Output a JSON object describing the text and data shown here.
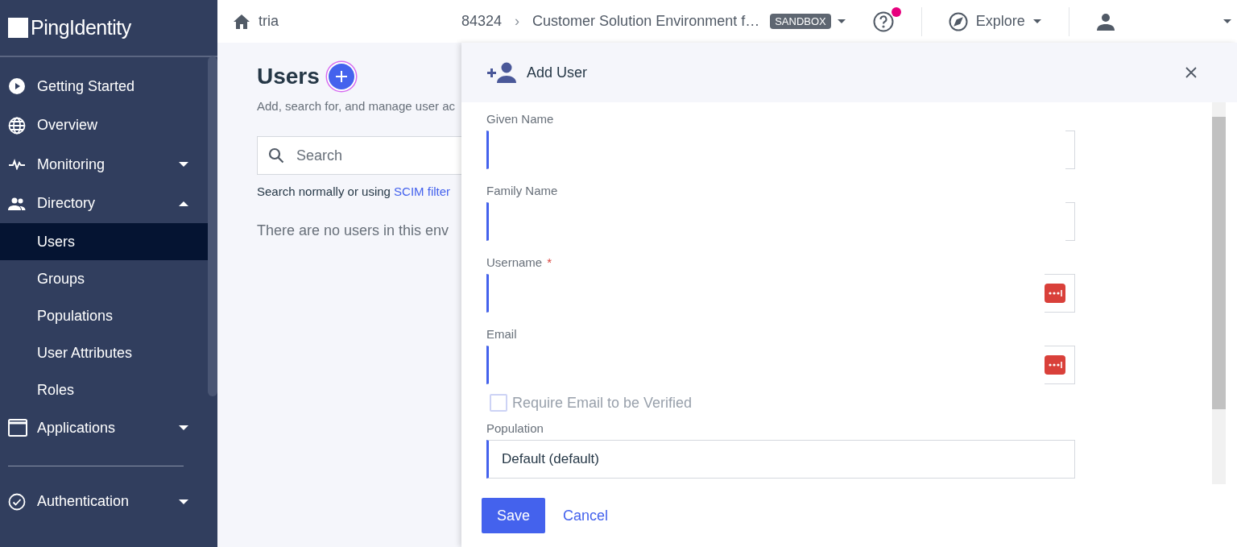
{
  "logo": {
    "text": "**Ping**Identity"
  },
  "topbar": {
    "home": "tria",
    "env_id": "84324",
    "separator": "›",
    "environment": "Customer Solution Environment f…",
    "badge": "SANDBOX",
    "help_notification": true,
    "explore": "Explore"
  },
  "sidebar": {
    "items": [
      {
        "kind": "section",
        "label": "Getting Started"
      },
      {
        "kind": "section",
        "label": "Overview"
      },
      {
        "kind": "section",
        "label": "Monitoring",
        "expanded": false
      },
      {
        "kind": "section",
        "label": "Directory",
        "expanded": true
      },
      {
        "kind": "child",
        "label": "Users",
        "selected": true
      },
      {
        "kind": "child",
        "label": "Groups",
        "selected": false
      },
      {
        "kind": "child",
        "label": "Populations",
        "selected": false
      },
      {
        "kind": "child",
        "label": "User Attributes",
        "selected": false
      },
      {
        "kind": "child",
        "label": "Roles",
        "selected": false
      },
      {
        "kind": "section",
        "label": "Applications",
        "expanded": false
      },
      {
        "kind": "divider"
      },
      {
        "kind": "section",
        "label": "Authentication",
        "expanded": false
      }
    ]
  },
  "page": {
    "title": "Users",
    "subtitle": "Add, search for, and manage user ac",
    "search": {
      "placeholder": "Search"
    },
    "hint": "Search normally or using ",
    "hint_link": "SCIM filter",
    "empty": "There are no users in this env"
  },
  "drawer": {
    "title": "Add User",
    "required_mark": "*",
    "fields": [
      {
        "kind": "text",
        "label": "Given Name",
        "required": false,
        "autofill": false
      },
      {
        "kind": "text",
        "label": "Family Name",
        "required": false,
        "autofill": false
      },
      {
        "kind": "text",
        "label": "Username",
        "required": true,
        "autofill": true
      },
      {
        "kind": "text",
        "label": "Email",
        "required": false,
        "autofill": true
      },
      {
        "kind": "checkbox",
        "label": "Require Email to be Verified",
        "checked": false
      },
      {
        "kind": "select",
        "label": "Population",
        "value": "Default (default)"
      }
    ],
    "buttons": [
      {
        "kind": "primary",
        "label": "Save"
      },
      {
        "kind": "link",
        "label": "Cancel"
      }
    ]
  }
}
